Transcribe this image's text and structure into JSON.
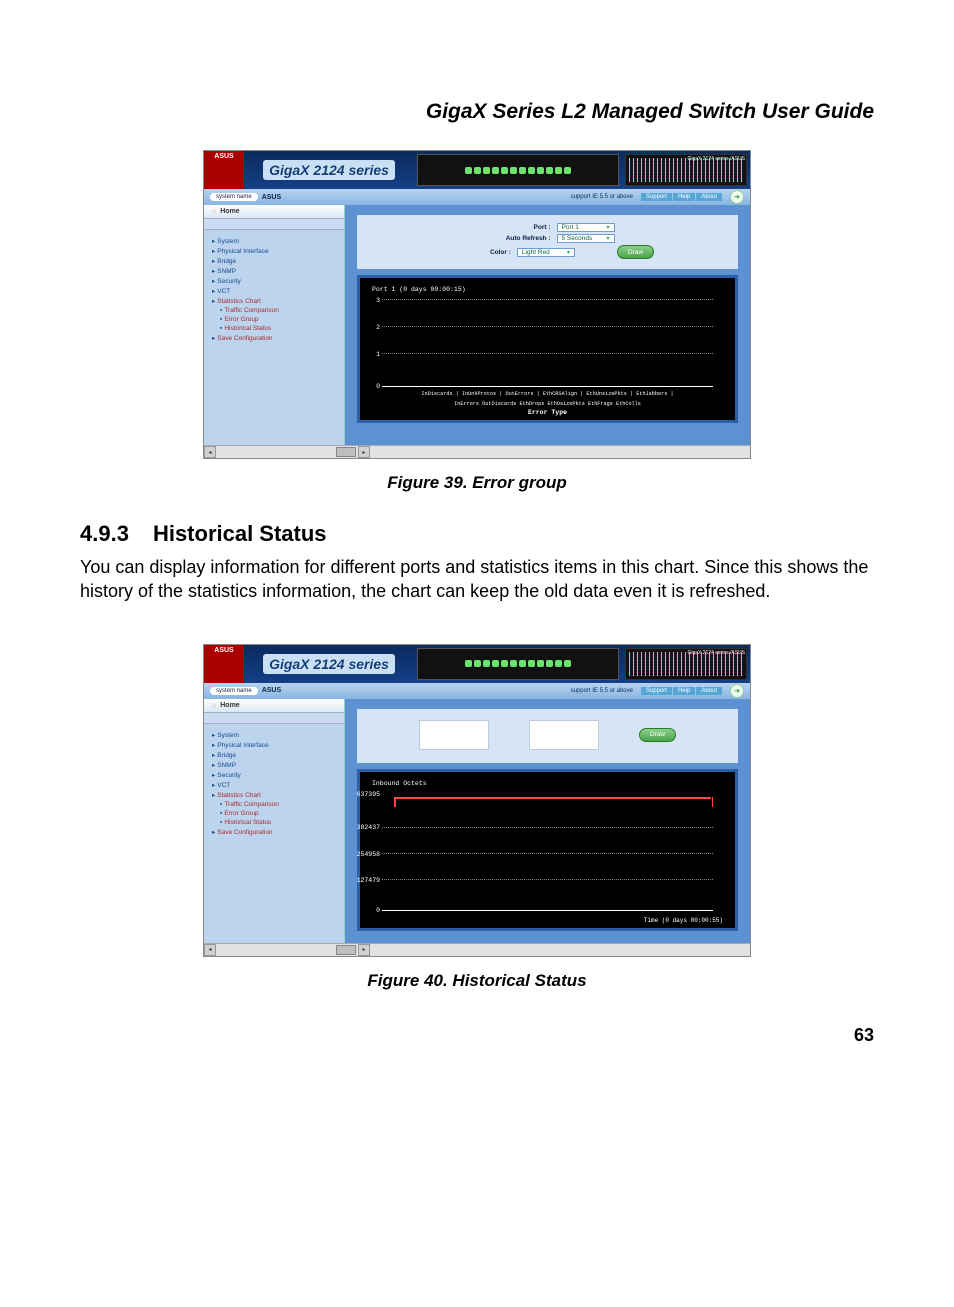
{
  "doc_title": "GigaX Series L2 Managed Switch User Guide",
  "page_number": "63",
  "fig39": {
    "caption": "Figure 39.  Error group",
    "brand": "GigaX 2124 series",
    "asus_badge": "ASUS",
    "corner": "GigaX 2124 series /ASUS",
    "system_name_label": "system name",
    "system_name_value": "ASUS",
    "support_note": "support IE 5.5 or above",
    "links": {
      "support": "Support",
      "help": "Help",
      "about": "About"
    },
    "home": "Home",
    "nav": [
      "System",
      "Physical Interface",
      "Bridge",
      "SNMP",
      "Security",
      "VCT",
      "Statistics Chart",
      "Traffic Comparison",
      "Error Group",
      "Historical Status",
      "Save Configuration"
    ],
    "nav_red_indices": [
      6,
      7,
      8,
      9,
      10
    ],
    "nav_indent_indices": [
      7,
      8,
      9
    ],
    "form": {
      "port_label": "Port :",
      "port_value": "Port 1",
      "refresh_label": "Auto Refresh :",
      "refresh_value": "5 Seconds",
      "color_label": "Color :",
      "color_value": "Light Red",
      "draw": "Draw"
    },
    "chart": {
      "title": "Port 1 (0 days 00:00:15)",
      "y_ticks": [
        "3",
        "2",
        "1",
        "0"
      ],
      "x_line1": "InDiscards | InUnkProtos | OutErrors | EthCRSAlign | EthUnsizePkts | EthJabbers |",
      "x_line2": "InErrors   OutDiscards   EthDrops   EthOsizePkts   EthFrags   EthColls",
      "x_label": "Error Type"
    }
  },
  "section": {
    "num": "4.9.3",
    "title": "Historical Status",
    "body": "You can display information for different ports and statistics items in this chart. Since this shows the history of the statistics information, the chart can keep the old data even it is refreshed."
  },
  "fig40": {
    "caption": "Figure 40.  Historical Status",
    "brand": "GigaX 2124 series",
    "asus_badge": "ASUS",
    "corner": "GigaX 2124 series /ASUS",
    "system_name_label": "system name",
    "system_name_value": "ASUS",
    "support_note": "support IE 5.5 or above",
    "links": {
      "support": "Support",
      "help": "Help",
      "about": "About"
    },
    "home": "Home",
    "nav": [
      "System",
      "Physical Interface",
      "Bridge",
      "SNMP",
      "Security",
      "VCT",
      "Statistics Chart",
      "Traffic Comparison",
      "Error Group",
      "Historical Status",
      "Save Configuration"
    ],
    "nav_red_indices": [
      6,
      7,
      8,
      9,
      10
    ],
    "nav_indent_indices": [
      7,
      8,
      9
    ],
    "draw": "Draw",
    "chart": {
      "title": "Inbound Octets",
      "y_ticks": [
        "637395",
        "382437",
        "254958",
        "127479",
        "0"
      ],
      "time_label": "Time (0 days 00:00:55)"
    }
  },
  "chart_data": [
    {
      "type": "bar",
      "title": "Port 1 (0 days 00:00:15)",
      "xlabel": "Error Type",
      "ylabel": "",
      "ylim": [
        0,
        3
      ],
      "categories": [
        "InDiscards",
        "InErrors",
        "InUnkProtos",
        "OutDiscards",
        "OutErrors",
        "EthDrops",
        "EthCRSAlign",
        "EthOsizePkts",
        "EthUnsizePkts",
        "EthFrags",
        "EthJabbers",
        "EthColls"
      ],
      "values": [
        0,
        0,
        0,
        0,
        0,
        0,
        0,
        0,
        0,
        0,
        0,
        0
      ]
    },
    {
      "type": "line",
      "title": "Inbound Octets",
      "xlabel": "Time (0 days 00:00:55)",
      "ylabel": "",
      "ylim": [
        0,
        637395
      ],
      "y_ticks": [
        0,
        127479,
        254958,
        382437,
        637395
      ],
      "series": [
        {
          "name": "Inbound Octets",
          "values": [
            637395,
            637395,
            637395,
            637395,
            637395,
            637395,
            637395,
            637395
          ]
        }
      ]
    }
  ]
}
